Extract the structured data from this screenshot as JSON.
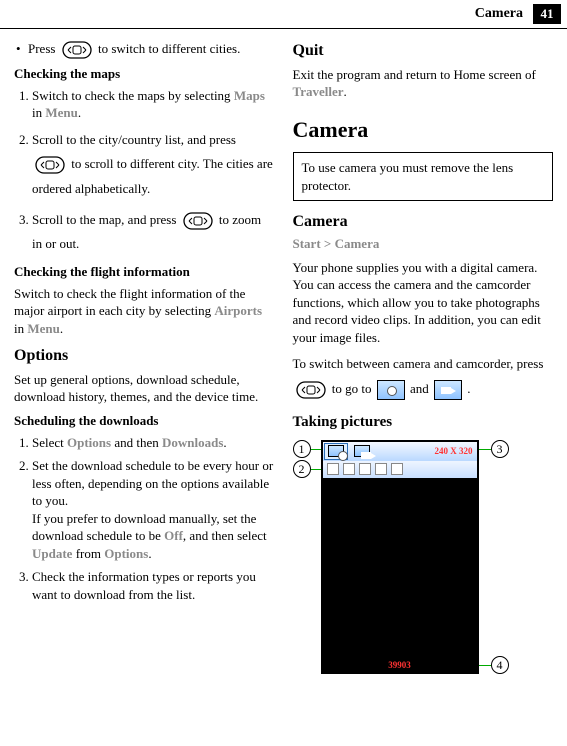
{
  "header": {
    "section": "Camera",
    "page": "41"
  },
  "left": {
    "bullet1a": "Press ",
    "bullet1b": " to switch to different cities.",
    "checkingMaps": "Checking the maps",
    "ol1_1a": "Switch to check the maps by selecting ",
    "ol1_1_maps": "Maps",
    "ol1_1b": " in ",
    "ol1_1_menu": "Menu",
    "ol1_1c": ".",
    "ol1_2a": "Scroll to the city/country list, and press ",
    "ol1_2b": " to scroll to different city. The cities are ordered alphabetically.",
    "ol1_3a": "Scroll to the map, and press ",
    "ol1_3b": " to zoom in or out.",
    "checkingFlight": "Checking the flight information",
    "flightPara_a": "Switch to check the flight information of the major airport in each city by selecting ",
    "flightPara_airports": "Airports",
    "flightPara_b": " in ",
    "flightPara_menu": "Menu",
    "flightPara_c": ".",
    "options": "Options",
    "optionsPara": "Set up general options, download schedule, download history, themes, and the device time.",
    "scheduling": "Scheduling the downloads",
    "ol2_1a": "Select ",
    "ol2_1_options": "Options",
    "ol2_1b": " and then ",
    "ol2_1_downloads": "Downloads",
    "ol2_1c": ".",
    "ol2_2a": "Set the download schedule to be every hour or less often, depending on the options available to you.",
    "ol2_2b": "If you prefer to download manually, set the download schedule to be ",
    "ol2_2_off": "Off",
    "ol2_2c": ", and then select ",
    "ol2_2_update": "Update",
    "ol2_2d": " from ",
    "ol2_2_options": "Options",
    "ol2_2e": ".",
    "ol2_3": "Check the information types or reports you want to download from the list."
  },
  "right": {
    "quit": "Quit",
    "quitPara_a": "Exit the program and return to Home screen of ",
    "quitPara_traveller": "Traveller",
    "quitPara_b": ".",
    "cameraBig": "Camera",
    "notice": "To use camera you must remove the lens protector.",
    "cameraSub": "Camera",
    "breadcrumb_a": "Start",
    "breadcrumb_sep": " > ",
    "breadcrumb_b": "Camera",
    "camPara": "Your phone supplies you with a digital camera. You can access the camera and the camcorder functions, which allow you to take photographs and record video clips. In addition, you can edit your image files.",
    "switchPara_a": "To switch between camera and camcorder, press ",
    "switchPara_b": " to go to ",
    "switchPara_c": " and ",
    "switchPara_d": " .",
    "taking": "Taking pictures",
    "diagram": {
      "res": "240 X 320",
      "counter": "39903",
      "c1": "1",
      "c2": "2",
      "c3": "3",
      "c4": "4"
    }
  }
}
